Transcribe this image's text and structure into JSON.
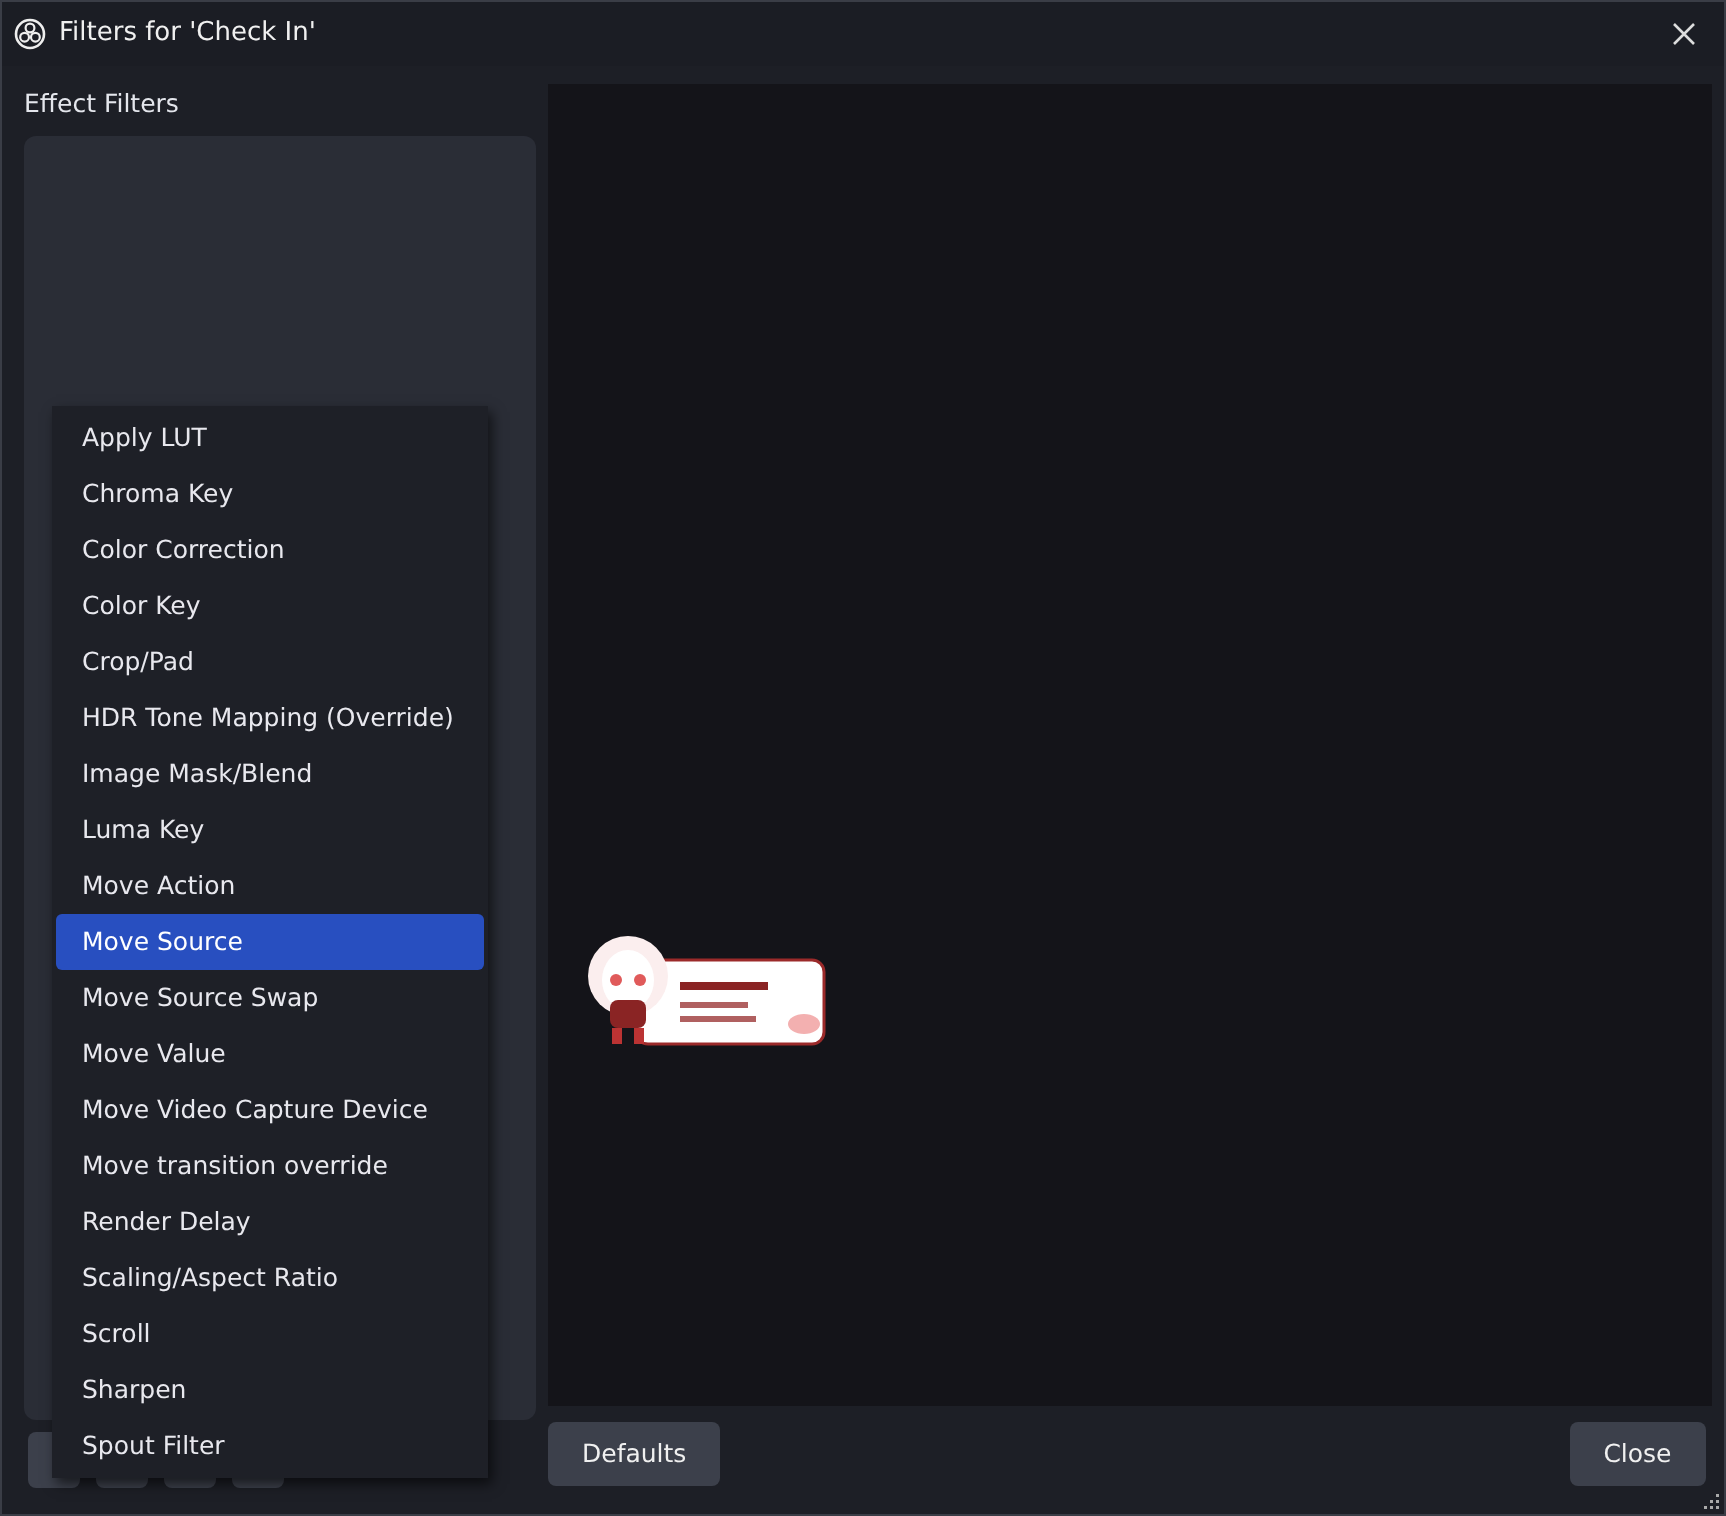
{
  "window": {
    "title": "Filters for 'Check In'"
  },
  "filters_panel": {
    "label": "Effect Filters"
  },
  "menu": [
    {
      "label": "Apply LUT",
      "selected": false
    },
    {
      "label": "Chroma Key",
      "selected": false
    },
    {
      "label": "Color Correction",
      "selected": false
    },
    {
      "label": "Color Key",
      "selected": false
    },
    {
      "label": "Crop/Pad",
      "selected": false
    },
    {
      "label": "HDR Tone Mapping (Override)",
      "selected": false
    },
    {
      "label": "Image Mask/Blend",
      "selected": false
    },
    {
      "label": "Luma Key",
      "selected": false
    },
    {
      "label": "Move Action",
      "selected": false
    },
    {
      "label": "Move Source",
      "selected": true
    },
    {
      "label": "Move Source Swap",
      "selected": false
    },
    {
      "label": "Move Value",
      "selected": false
    },
    {
      "label": "Move Video Capture Device",
      "selected": false
    },
    {
      "label": "Move transition override",
      "selected": false
    },
    {
      "label": "Render Delay",
      "selected": false
    },
    {
      "label": "Scaling/Aspect Ratio",
      "selected": false
    },
    {
      "label": "Scroll",
      "selected": false
    },
    {
      "label": "Sharpen",
      "selected": false
    },
    {
      "label": "Spout Filter",
      "selected": false
    }
  ],
  "buttons": [
    "Defaults",
    "Close"
  ]
}
